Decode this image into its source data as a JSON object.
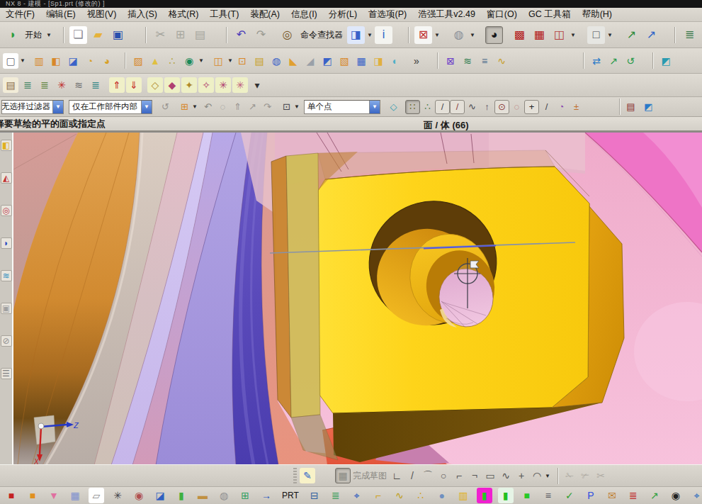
{
  "window": {
    "title": "NX 8 - 建模 - [Sp1.prt (修改的) ]"
  },
  "menu_bar": {
    "items": [
      "文件(F)",
      "编辑(E)",
      "视图(V)",
      "插入(S)",
      "格式(R)",
      "工具(T)",
      "装配(A)",
      "信息(I)",
      "分析(L)",
      "首选项(P)",
      "浩强工具v2.49",
      "窗口(O)",
      "GC 工具箱",
      "帮助(H)"
    ]
  },
  "toolbar_row1": {
    "icons": [
      {
        "n": "start-button",
        "g": "◑",
        "c": "#2f9e3f",
        "label": "开始",
        "arrow": true
      },
      {
        "gap": 6
      },
      {
        "sep": true
      },
      {
        "n": "new-file-button",
        "g": "❏",
        "c": "#8a8a92",
        "bg": "#ffffff"
      },
      {
        "n": "open-button",
        "g": "▰",
        "c": "#e6b23a"
      },
      {
        "n": "save-button",
        "g": "▣",
        "c": "#2a4fae"
      },
      {
        "gap": 16
      },
      {
        "sep": true
      },
      {
        "n": "cut-button",
        "g": "✂",
        "c": "#a2a29a"
      },
      {
        "n": "copy-button",
        "g": "⊞",
        "c": "#a8a8a0"
      },
      {
        "n": "paste-button",
        "g": "▤",
        "c": "#a8a8a0"
      },
      {
        "gap": 14
      },
      {
        "sep": true
      },
      {
        "n": "undo-button",
        "g": "↶",
        "c": "#4a3ab8"
      },
      {
        "n": "redo-button",
        "g": "↷",
        "c": "#9a9a92"
      },
      {
        "gap": 6
      },
      {
        "n": "command-finder-button",
        "g": "◎",
        "c": "#7a5a2a",
        "label": "命令查找器"
      },
      {
        "n": "assembly-cube-button",
        "g": "◨",
        "c": "#3a62c8",
        "bg": "#dfe8fa",
        "arrow": true
      },
      {
        "n": "info-button",
        "g": "i",
        "c": "#2a62c8",
        "bg": "#f4f4f0"
      },
      {
        "gap": 12
      },
      {
        "sep": true
      },
      {
        "n": "window-layout-button",
        "g": "⊠",
        "c": "#c03030",
        "bg": "#f6f6f4",
        "arrow": true
      },
      {
        "gap": 8
      },
      {
        "n": "shaded-view-button",
        "g": "◍",
        "c": "#8a9098",
        "arrow": true
      },
      {
        "gap": 8
      },
      {
        "n": "render-style-button",
        "g": "◕",
        "c": "#18181c",
        "pressed": true
      },
      {
        "gap": 5
      },
      {
        "n": "section-x-button",
        "g": "▩",
        "c": "#b42222"
      },
      {
        "n": "section-y-button",
        "g": "▦",
        "c": "#b42222"
      },
      {
        "n": "section-z-button",
        "g": "◫",
        "c": "#b44040",
        "arrow": true
      },
      {
        "gap": 10
      },
      {
        "n": "background-button",
        "g": "□",
        "c": "#44444c",
        "bg": "#e6e6e2",
        "arrow": true
      },
      {
        "gap": 8
      },
      {
        "n": "open-in-window-button",
        "g": "↗",
        "c": "#2a8a3a"
      },
      {
        "n": "new-window-button",
        "g": "↗",
        "c": "#2a62c8"
      },
      {
        "gap": 10
      },
      {
        "sep": true
      },
      {
        "n": "layer-list-button",
        "g": "≣",
        "c": "#3a7a4a"
      },
      {
        "n": "wcs-button",
        "g": "↻",
        "c": "#d8862a",
        "arrow": true
      }
    ]
  },
  "toolbar_row2": {
    "icons": [
      {
        "n": "display-mode-button",
        "g": "▢",
        "c": "#66666e",
        "bg": "#ffffff",
        "arrow": true
      },
      {
        "gap": 4
      },
      {
        "n": "pattern-feature-button",
        "g": "▥",
        "c": "#d8882a"
      },
      {
        "n": "split-body-button",
        "g": "◧",
        "c": "#d8882a"
      },
      {
        "n": "boss-button",
        "g": "◪",
        "c": "#3a62c8"
      },
      {
        "n": "pocket-button",
        "g": "◔",
        "c": "#d8a22a"
      },
      {
        "n": "dome-button",
        "g": "◕",
        "c": "#d8a22a"
      },
      {
        "gap": 6
      },
      {
        "sep": true
      },
      {
        "n": "emboss-button",
        "g": "▨",
        "c": "#d8882a"
      },
      {
        "n": "lamp-button",
        "g": "▲",
        "c": "#e0c040"
      },
      {
        "n": "datum-network-button",
        "g": "∴",
        "c": "#b0a030"
      },
      {
        "n": "synchronous-button",
        "g": "◉",
        "c": "#1a8a5a",
        "arrow": true
      },
      {
        "gap": 5
      },
      {
        "n": "linked-body-button",
        "g": "◫",
        "c": "#d8882a",
        "arrow": true
      },
      {
        "n": "extract-body-button",
        "g": "⊡",
        "c": "#d8882a"
      },
      {
        "n": "sheet-body-button",
        "g": "▤",
        "c": "#c8a02a"
      },
      {
        "n": "sphere-button",
        "g": "◍",
        "c": "#3a62c8"
      },
      {
        "n": "block-corner-button",
        "g": "◣",
        "c": "#e0a030"
      },
      {
        "n": "trim-body-button",
        "g": "◢",
        "c": "#9aa0a8"
      },
      {
        "n": "offset-surface-button",
        "g": "◩",
        "c": "#3a62c8"
      },
      {
        "n": "thicken-button",
        "g": "▧",
        "c": "#d8882a"
      },
      {
        "n": "sew-button",
        "g": "▦",
        "c": "#3a62c8"
      },
      {
        "n": "patch-button",
        "g": "◨",
        "c": "#e0b040"
      },
      {
        "n": "foil-button",
        "g": "◐",
        "c": "#50b0c8"
      },
      {
        "gap": 4
      },
      {
        "n": "overflow-button",
        "g": "»",
        "c": "#333333"
      },
      {
        "gap": 10
      },
      {
        "sep": true
      },
      {
        "n": "region-select-button",
        "g": "⊠",
        "c": "#6a3ac8"
      },
      {
        "n": "layer-visible-button",
        "g": "≋",
        "c": "#2a7a4a"
      },
      {
        "n": "layer-category-button",
        "g": "≡",
        "c": "#4a6a8a"
      },
      {
        "n": "move-component-button",
        "g": "∿",
        "c": "#c8a02a"
      },
      {
        "gap": 96
      },
      {
        "sep": true
      },
      {
        "n": "add-component-button",
        "g": "⇄",
        "c": "#2a7ac8"
      },
      {
        "n": "new-component-button",
        "g": "↗",
        "c": "#2a9a4a"
      },
      {
        "n": "mirror-assembly-button",
        "g": "↺",
        "c": "#2a9a4a"
      },
      {
        "gap": 12
      },
      {
        "sep": true
      },
      {
        "n": "teal-cube-button",
        "g": "◩",
        "c": "#2a9ab0"
      }
    ]
  },
  "toolbar_row3": {
    "icons": [
      {
        "n": "clipboard-button",
        "g": "▤",
        "c": "#8a6a4a",
        "bg": "#f2ecd8"
      },
      {
        "n": "layer-stack-button-1",
        "g": "≣",
        "c": "#4a8a6a"
      },
      {
        "n": "layer-stack-button-2",
        "g": "≣",
        "c": "#6a8a4a"
      },
      {
        "n": "layer-cross-button",
        "g": "✳",
        "c": "#c03030"
      },
      {
        "n": "layer-search-button",
        "g": "≋",
        "c": "#6a6a6a"
      },
      {
        "n": "layer-stack-button-3",
        "g": "≣",
        "c": "#3a8a8a"
      },
      {
        "gap": 4
      },
      {
        "n": "move-layer-up-button",
        "g": "⇑",
        "c": "#c42424",
        "bg": "#f0f0c8"
      },
      {
        "n": "move-layer-down-button",
        "g": "⇓",
        "c": "#c42424",
        "bg": "#f0f0c8"
      },
      {
        "gap": 4
      },
      {
        "n": "datum-plane-button-1",
        "g": "◇",
        "c": "#b08a2a",
        "bg": "#eef0c6"
      },
      {
        "n": "datum-plane-button-2",
        "g": "◆",
        "c": "#b04070",
        "bg": "#eef0c6"
      },
      {
        "n": "datum-plane-button-3",
        "g": "✦",
        "c": "#b08a2a",
        "bg": "#eef0c6"
      },
      {
        "n": "datum-plane-button-4",
        "g": "✧",
        "c": "#b04070",
        "bg": "#eef0c6"
      },
      {
        "n": "datum-plane-button-5",
        "g": "✳",
        "c": "#b04070",
        "bg": "#eef0c6"
      },
      {
        "n": "datum-plane-button-6",
        "g": "✳",
        "c": "#c06080",
        "bg": "#eef0c6"
      },
      {
        "n": "row3-more-button",
        "g": "▾",
        "c": "#333333"
      }
    ]
  },
  "selection_bar": {
    "filter_value": "无选择过滤器",
    "scope_value": "仅在工作部件内部",
    "point_value": "单个点",
    "tools": [
      {
        "n": "snail-button",
        "g": "↺",
        "c": "#9a9691"
      },
      {
        "gap": 6
      },
      {
        "n": "select-scope-button",
        "g": "⊞",
        "c": "#d8882a",
        "arrow": true
      },
      {
        "gap": 4
      },
      {
        "n": "reverse-selection-button",
        "g": "↶",
        "c": "#8a8a84"
      },
      {
        "n": "ghost-cube-button",
        "g": "◌",
        "c": "#8a8a84"
      },
      {
        "n": "up-select-button",
        "g": "⇑",
        "c": "#9a9691"
      },
      {
        "n": "forward-select-button",
        "g": "↗",
        "c": "#9a9691"
      },
      {
        "n": "back-select-button",
        "g": "↷",
        "c": "#9a9691"
      },
      {
        "gap": 6
      },
      {
        "n": "marquee-button",
        "g": "⊡",
        "c": "#44444c",
        "arrow": true
      }
    ],
    "snaps": [
      {
        "n": "snap-point-dialog-button",
        "g": "◇",
        "c": "#2a9ab0"
      },
      {
        "gap": 6
      },
      {
        "n": "snap-grid-button",
        "g": "∷",
        "c": "#6a6a2a",
        "pressed": true
      },
      {
        "n": "snap-cluster-button",
        "g": "∴",
        "c": "#4a7a4a"
      },
      {
        "n": "snap-endpoint-button",
        "g": "/",
        "c": "#44444c",
        "boxed": true
      },
      {
        "n": "snap-midpoint-button",
        "g": "/",
        "c": "#8a4040",
        "boxed": true
      },
      {
        "n": "snap-spline-button",
        "g": "∿",
        "c": "#44444c"
      },
      {
        "n": "snap-pole-button",
        "g": "↑",
        "c": "#44444c"
      },
      {
        "n": "snap-center-button",
        "g": "⊙",
        "c": "#8a3a3a",
        "boxed": true
      },
      {
        "n": "snap-quadrant-button",
        "g": "◌",
        "c": "#b05050"
      },
      {
        "n": "snap-intersection-button",
        "g": "+",
        "c": "#222222",
        "boxed": true
      },
      {
        "n": "snap-point-on-curve-button",
        "g": "/",
        "c": "#44444c"
      },
      {
        "n": "snap-face-button",
        "g": "◔",
        "c": "#8a4ab0"
      },
      {
        "n": "snap-point-on-face-button",
        "g": "±",
        "c": "#c07030"
      },
      {
        "gap": 46
      },
      {
        "sep": true
      },
      {
        "n": "snap-book-button",
        "g": "▤",
        "c": "#8a3030"
      },
      {
        "gap": 4
      },
      {
        "n": "snap-cube-button",
        "g": "◩",
        "c": "#2a7ac8"
      }
    ]
  },
  "prompt_bar": {
    "prompt": "择要草绘的平的面或指定点",
    "status": "面 / 体 (66)"
  },
  "sketch_toolbar": {
    "left_icons": [
      {
        "n": "sketch-task-icon",
        "g": "✎",
        "c": "#2a62c8",
        "bg": "#f8f2c8"
      },
      {
        "gap": 28
      },
      {
        "n": "sketch-update-button",
        "g": "▦",
        "c": "#8a8a84",
        "pressed": true
      }
    ],
    "finish_label": "完成草图",
    "tools": [
      {
        "n": "profile-button",
        "g": "∟",
        "c": "#333333"
      },
      {
        "n": "line-button",
        "g": "/",
        "c": "#555555"
      },
      {
        "n": "arc-button",
        "g": "⌒",
        "c": "#555555"
      },
      {
        "n": "circle-button",
        "g": "○",
        "c": "#555555"
      },
      {
        "n": "fillet-button",
        "g": "⌐",
        "c": "#555555"
      },
      {
        "n": "chamfer-button",
        "g": "¬",
        "c": "#555555"
      },
      {
        "n": "rectangle-button",
        "g": "▭",
        "c": "#555555"
      },
      {
        "n": "studio-spline-button",
        "g": "∿",
        "c": "#555555"
      },
      {
        "n": "point-button",
        "g": "+",
        "c": "#555555"
      },
      {
        "n": "shape-button",
        "g": "◠",
        "c": "#555555",
        "arrow": true
      },
      {
        "gap": 6
      },
      {
        "sep": true
      },
      {
        "n": "quick-trim-button",
        "g": "✁",
        "c": "#b0aca4"
      },
      {
        "n": "quick-extend-button",
        "g": "✃",
        "c": "#b0aca4"
      },
      {
        "n": "make-corner-button",
        "g": "✂",
        "c": "#b0aca4"
      }
    ]
  },
  "bottom_toolbar": {
    "icons": [
      {
        "n": "red-cube-tool",
        "g": "■",
        "c": "#c42222"
      },
      {
        "n": "orange-box-tool",
        "g": "■",
        "c": "#e09020"
      },
      {
        "n": "pink-drill-tool",
        "g": "▼",
        "c": "#e070a0"
      },
      {
        "n": "grid-plane-tool",
        "g": "▦",
        "c": "#8090d0"
      },
      {
        "n": "white-plane-tool",
        "g": "▱",
        "c": "#88888a",
        "bg": "#ffffff"
      },
      {
        "n": "xform-tool",
        "g": "✳",
        "c": "#44444c"
      },
      {
        "n": "compass-tool",
        "g": "◉",
        "c": "#b05050"
      },
      {
        "n": "blue-wedge-tool",
        "g": "◪",
        "c": "#3060c0"
      },
      {
        "n": "rainbow-tool",
        "g": "▮",
        "c": "#40b040"
      },
      {
        "n": "plank-tool",
        "g": "▬",
        "c": "#c09040"
      },
      {
        "n": "swirl-cube-tool",
        "g": "◍",
        "c": "#909090"
      },
      {
        "n": "cubes-tool",
        "g": "⊞",
        "c": "#30a060"
      },
      {
        "n": "prt-export-tool",
        "g": "→",
        "c": "#2050c0",
        "label": "PRT"
      },
      {
        "n": "part-navigator-tool",
        "g": "⊟",
        "c": "#3060a0"
      },
      {
        "n": "layer-tool",
        "g": "≣",
        "c": "#40a060"
      },
      {
        "n": "pin-tool",
        "g": "⌖",
        "c": "#3060c0"
      },
      {
        "n": "connector-tool",
        "g": "⌐",
        "c": "#d0a020"
      },
      {
        "n": "brush-tool",
        "g": "∿",
        "c": "#c0a020"
      },
      {
        "n": "person-tool",
        "g": "∴",
        "c": "#d0a020"
      },
      {
        "n": "cylinder-tool",
        "g": "●",
        "c": "#7090c0"
      },
      {
        "n": "yellow-stack-tool",
        "g": "▥",
        "c": "#e0b020"
      },
      {
        "n": "magenta-panel-tool",
        "g": "▮",
        "c": "#22c822",
        "bg": "#f020d0"
      },
      {
        "n": "battery-tool",
        "g": "▮",
        "c": "#20c020",
        "bg": "#e6f4e6"
      },
      {
        "n": "green-panel-tool",
        "g": "■",
        "c": "#28c828"
      },
      {
        "n": "ruler-tool",
        "g": "≡",
        "c": "#55555d"
      },
      {
        "n": "fern-tool",
        "g": "✓",
        "c": "#30a030"
      },
      {
        "n": "bold-p-tool",
        "g": "P",
        "c": "#3050e0"
      },
      {
        "n": "envelope-tool",
        "g": "✉",
        "c": "#c08030"
      },
      {
        "n": "pin-list-tool",
        "g": "≣",
        "c": "#c03030"
      },
      {
        "n": "cube-arrow-tool",
        "g": "↗",
        "c": "#30a040"
      },
      {
        "n": "panda-tool",
        "g": "◉",
        "c": "#222222"
      },
      {
        "n": "probe-tool",
        "g": "⌖",
        "c": "#3070c0"
      },
      {
        "n": "plus-tool",
        "g": "+",
        "c": "#44444c"
      }
    ]
  },
  "side_toolbar": {
    "icons": [
      {
        "n": "side-tool-1",
        "g": "◧",
        "c": "#e0b020"
      },
      {
        "n": "side-tool-2",
        "g": "◭",
        "c": "#c03030"
      },
      {
        "n": "side-tool-3",
        "g": "◎",
        "c": "#c04050"
      },
      {
        "n": "side-tool-4",
        "g": "◗",
        "c": "#3050c0"
      },
      {
        "n": "side-tool-5",
        "g": "≋",
        "c": "#3090c0"
      },
      {
        "n": "side-tool-6",
        "g": "▣",
        "c": "#a0a0a0"
      },
      {
        "n": "side-tool-7",
        "g": "⊘",
        "c": "#909090"
      },
      {
        "n": "side-tool-8",
        "g": "☰",
        "c": "#808080"
      }
    ]
  },
  "viewport": {
    "triad": {
      "z_label": "Z",
      "x_label": "X"
    },
    "colors": {
      "background_pink": "#f2b2d2",
      "magenta_blob": "#ee74c6",
      "salmon": "#d99b94",
      "band_orange": "#e2a351",
      "band_purple": "#4c3eb0",
      "band_lavender": "#b7a8e8",
      "part_yellow": "#fcd012",
      "part_side_orange": "#eda913",
      "part_bottom_brown": "#6e4d09",
      "hole_dark": "#5e3d08",
      "sketch_line_blue": "#5558dd"
    }
  }
}
